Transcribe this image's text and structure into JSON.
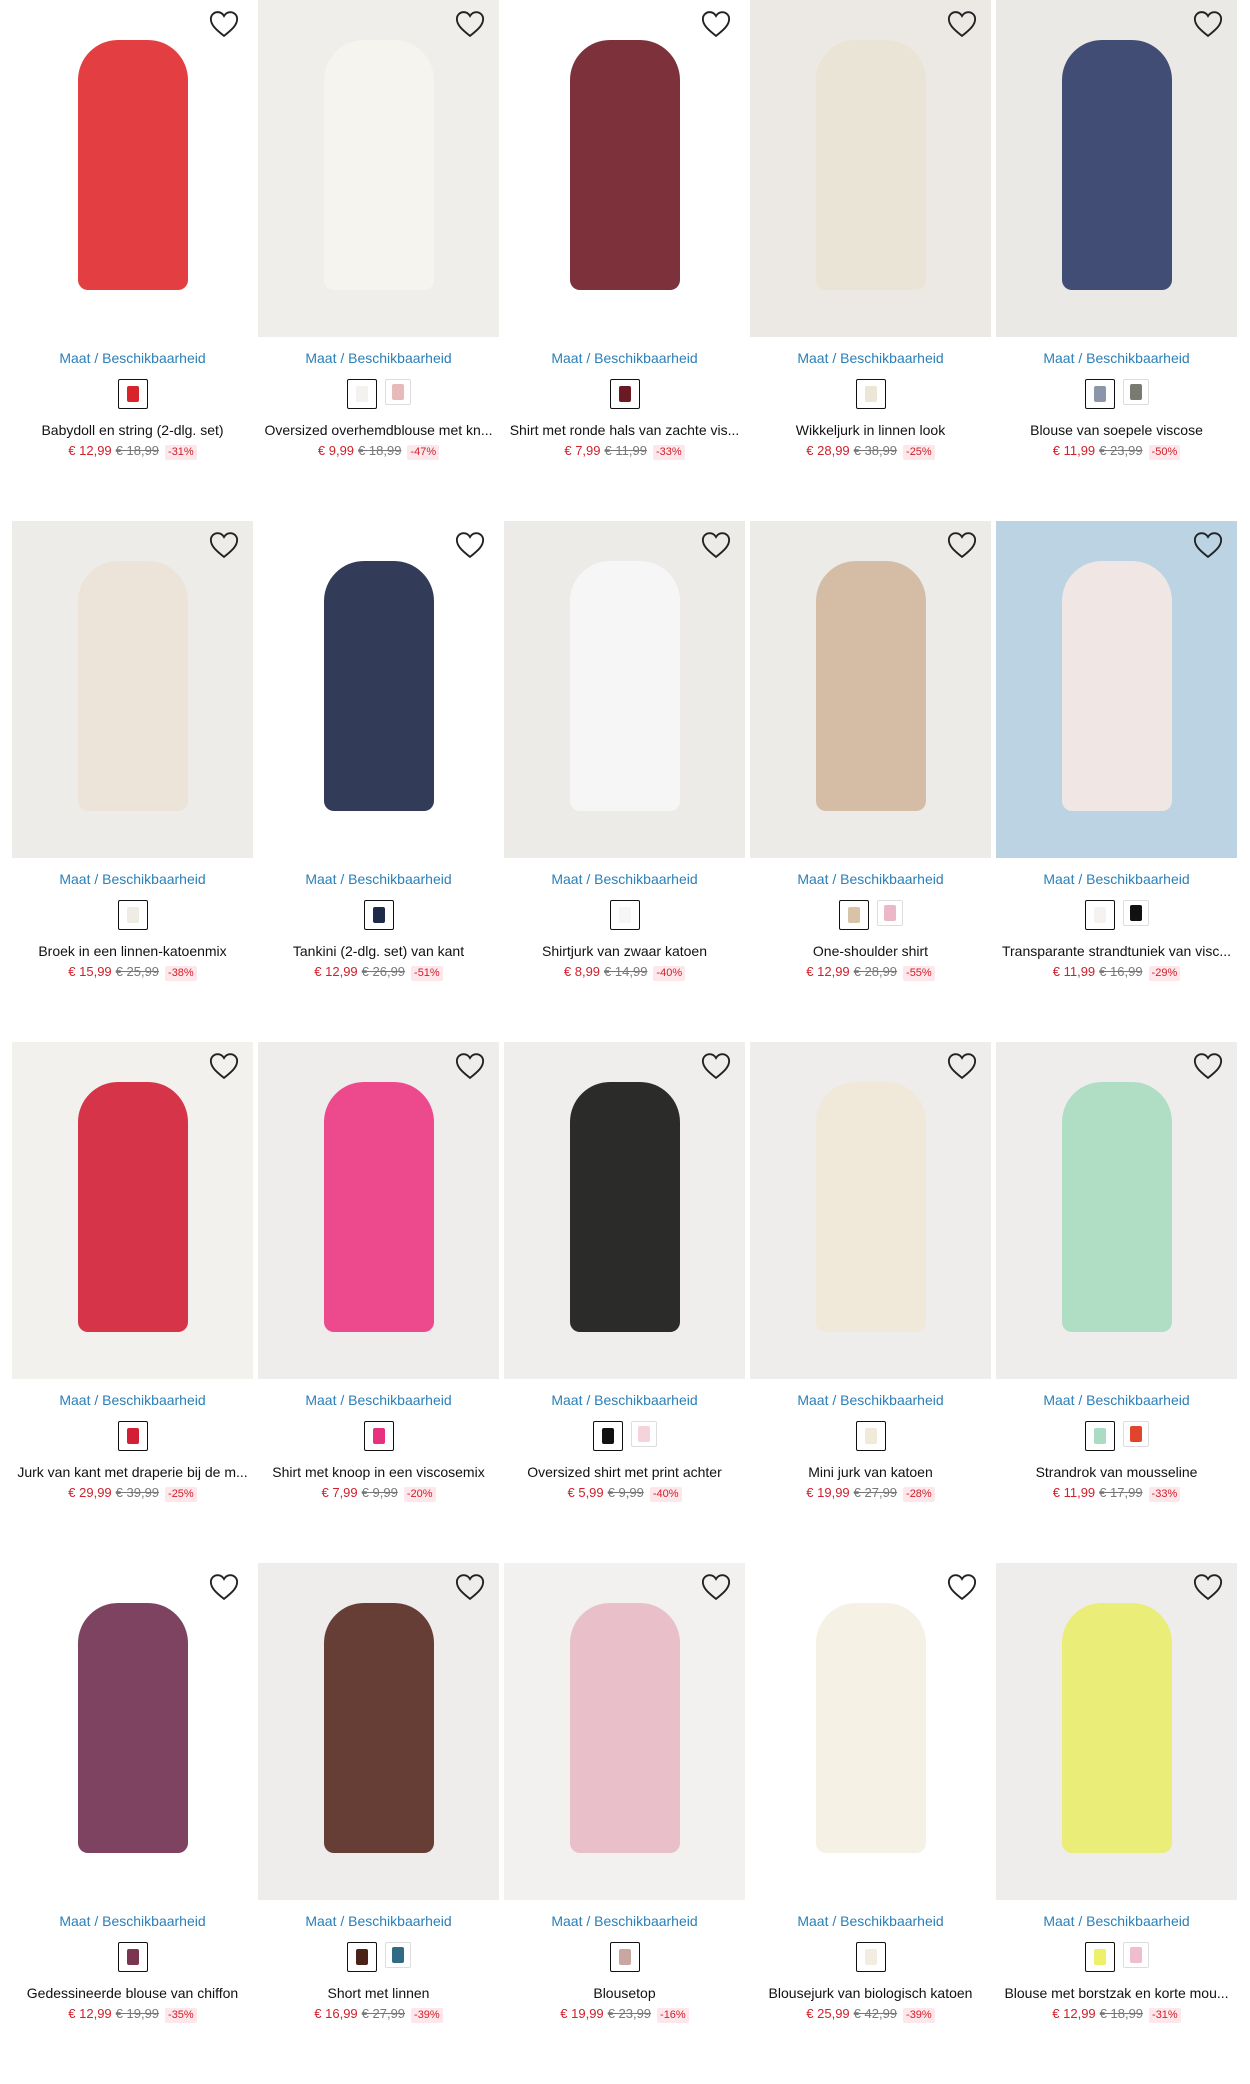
{
  "labels": {
    "size_link": "Maat / Beschikbaarheid"
  },
  "colors": {
    "accent_link": "#2a7fb8",
    "sale_price": "#d0202b",
    "discount_bg": "#fde7ea"
  },
  "products": [
    {
      "name": "Babydoll en string (2-dlg. set)",
      "price": "€ 12,99",
      "old_price": "€ 18,99",
      "discount": "-31%",
      "swatches": [
        "#d8232a"
      ],
      "garment": "#e02a2e",
      "bg": "#ffffff"
    },
    {
      "name": "Oversized overhemdblouse met kn...",
      "price": "€ 9,99",
      "old_price": "€ 18,99",
      "discount": "-47%",
      "swatches": [
        "#f4f2ee",
        "#e8b9b9"
      ],
      "garment": "#f5f4f0",
      "bg": "#f0eeea"
    },
    {
      "name": "Shirt met ronde hals van zachte vis...",
      "price": "€ 7,99",
      "old_price": "€ 11,99",
      "discount": "-33%",
      "swatches": [
        "#6b1a24"
      ],
      "garment": "#6e1b26",
      "bg": "#ffffff"
    },
    {
      "name": "Wikkeljurk in linnen look",
      "price": "€ 28,99",
      "old_price": "€ 38,99",
      "discount": "-25%",
      "swatches": [
        "#ece6d6"
      ],
      "garment": "#e9e3d3",
      "bg": "#ece9e4"
    },
    {
      "name": "Blouse van soepele viscose",
      "price": "€ 11,99",
      "old_price": "€ 23,99",
      "discount": "-50%",
      "swatches": [
        "#8d96a8",
        "#7a7a72"
      ],
      "garment": "#2f3c67",
      "bg": "#ebe9e6"
    },
    {
      "name": "Broek in een linnen-katoenmix",
      "price": "€ 15,99",
      "old_price": "€ 25,99",
      "discount": "-38%",
      "swatches": [
        "#efece5"
      ],
      "garment": "#ebe3d6",
      "bg": "#eeece8"
    },
    {
      "name": "Tankini (2-dlg. set) van kant",
      "price": "€ 12,99",
      "old_price": "€ 26,99",
      "discount": "-51%",
      "swatches": [
        "#1d2a4a"
      ],
      "garment": "#1c2747",
      "bg": "#ffffff"
    },
    {
      "name": "Shirtjurk van zwaar katoen",
      "price": "€ 8,99",
      "old_price": "€ 14,99",
      "discount": "-40%",
      "swatches": [
        "#f6f6f6"
      ],
      "garment": "#f7f7f7",
      "bg": "#ecebe8"
    },
    {
      "name": "One-shoulder shirt",
      "price": "€ 12,99",
      "old_price": "€ 28,99",
      "discount": "-55%",
      "swatches": [
        "#d8c2a8",
        "#eab8c6"
      ],
      "garment": "#d1b89c",
      "bg": "#ecebe8"
    },
    {
      "name": "Transparante strandtuniek van visc...",
      "price": "€ 11,99",
      "old_price": "€ 16,99",
      "discount": "-29%",
      "swatches": [
        "#f6f2ef",
        "#111111"
      ],
      "garment": "#f5e9e4",
      "bg": "#bcd3e3"
    },
    {
      "name": "Jurk van kant met draperie bij de m...",
      "price": "€ 29,99",
      "old_price": "€ 39,99",
      "discount": "-25%",
      "swatches": [
        "#d21f35"
      ],
      "garment": "#d11f36",
      "bg": "#f3f1ee"
    },
    {
      "name": "Shirt met knoop in een viscosemix",
      "price": "€ 7,99",
      "old_price": "€ 9,99",
      "discount": "-20%",
      "swatches": [
        "#e8317e"
      ],
      "garment": "#ec3683",
      "bg": "#eeedeb"
    },
    {
      "name": "Oversized shirt met print achter",
      "price": "€ 5,99",
      "old_price": "€ 9,99",
      "discount": "-40%",
      "swatches": [
        "#111111",
        "#f4d4da"
      ],
      "garment": "#151515",
      "bg": "#efeeec"
    },
    {
      "name": "Mini jurk van katoen",
      "price": "€ 19,99",
      "old_price": "€ 27,99",
      "discount": "-28%",
      "swatches": [
        "#f1ead9"
      ],
      "garment": "#efe7d6",
      "bg": "#eeedeb"
    },
    {
      "name": "Strandrok van mousseline",
      "price": "€ 11,99",
      "old_price": "€ 17,99",
      "discount": "-33%",
      "swatches": [
        "#a9dcc2",
        "#e2452e"
      ],
      "garment": "#a7dcc0",
      "bg": "#eeedeb"
    },
    {
      "name": "Gedessineerde blouse van chiffon",
      "price": "€ 12,99",
      "old_price": "€ 19,99",
      "discount": "-35%",
      "swatches": [
        "#7a3550"
      ],
      "garment": "#6f2f4f",
      "bg": "#ffffff"
    },
    {
      "name": "Short met linnen",
      "price": "€ 16,99",
      "old_price": "€ 27,99",
      "discount": "-39%",
      "swatches": [
        "#4b2218",
        "#2f6b86"
      ],
      "garment": "#562a21",
      "bg": "#eeedeb"
    },
    {
      "name": "Blousetop",
      "price": "€ 19,99",
      "old_price": "€ 23,99",
      "discount": "-16%",
      "swatches": [
        "#c9a7a0"
      ],
      "garment": "#e8b9c4",
      "bg": "#f2f1ef"
    },
    {
      "name": "Blousejurk van biologisch katoen",
      "price": "€ 25,99",
      "old_price": "€ 42,99",
      "discount": "-39%",
      "swatches": [
        "#f2ede0"
      ],
      "garment": "#f4efe1",
      "bg": "#ffffff"
    },
    {
      "name": "Blouse met borstzak en korte mou...",
      "price": "€ 12,99",
      "old_price": "€ 18,99",
      "discount": "-31%",
      "swatches": [
        "#eef06a",
        "#f0bcd0"
      ],
      "garment": "#e9ec6a",
      "bg": "#eeedeb"
    }
  ]
}
